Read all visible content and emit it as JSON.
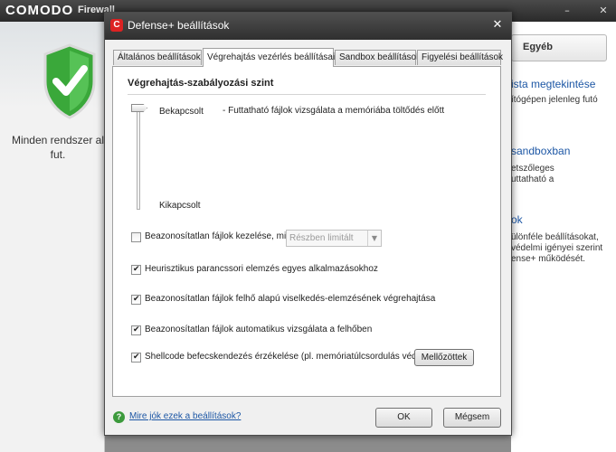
{
  "background": {
    "brand": "COMODO",
    "product": "Firewall",
    "status_text_line1": "Minden rendszer al",
    "status_text_line2": "fut.",
    "tab_label": "Egyéb",
    "links": [
      {
        "title": "ista megtekintése",
        "desc": [
          "ítógépen jelenleg futó"
        ]
      },
      {
        "title": "sandboxban",
        "desc": [
          "etszőleges",
          "uttatható a"
        ]
      },
      {
        "title": "ok",
        "desc": [
          "ülönféle beállításokat,",
          "védelmi igényei szerint",
          "ense+ működését."
        ]
      }
    ]
  },
  "dialog": {
    "title": "Defense+ beállítások",
    "tabs": [
      {
        "label": "Általános beállítások",
        "active": false
      },
      {
        "label": "Végrehajtás vezérlés beállításai",
        "active": true
      },
      {
        "label": "Sandbox beállítások",
        "active": false
      },
      {
        "label": "Figyelési beállítások",
        "active": false
      }
    ],
    "section_title": "Végrehajtás-szabályozási szint",
    "slider": {
      "top_label": "Bekapcsolt",
      "top_description": "- Futtatható fájlok vizsgálata a memóriába töltődés előtt",
      "bottom_label": "Kikapcsolt",
      "current_level": "Bekapcsolt"
    },
    "options": [
      {
        "label": "Beazonosítatlan fájlok kezelése, mint",
        "checked": false
      },
      {
        "label": "Heurisztikus parancssori elemzés egyes alkalmazásokhoz",
        "checked": true
      },
      {
        "label": "Beazonosítatlan fájlok felhő alapú viselkedés-elemzésének végrehajtása",
        "checked": true
      },
      {
        "label": "Beazonosítatlan fájlok automatikus vizsgálata a felhőben",
        "checked": true
      },
      {
        "label": "Shellcode befecskendezés érzékelése (pl. memóriatúlcsordulás védelem)",
        "checked": true
      }
    ],
    "select": {
      "value": "Részben limitált"
    },
    "exclusions_button": "Mellőzöttek",
    "help_link": "Mire jók ezek a beállítások?",
    "ok_button": "OK",
    "cancel_button": "Mégsem"
  }
}
